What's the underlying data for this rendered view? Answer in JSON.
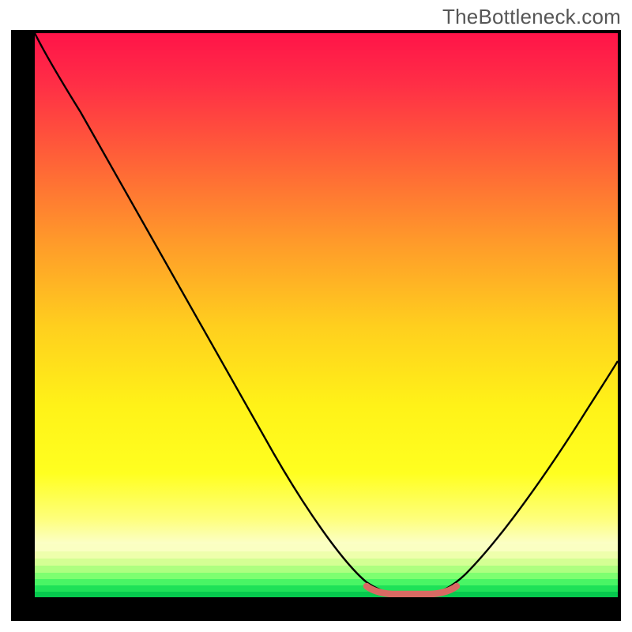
{
  "watermark": "TheBottleneck.com",
  "chart_data": {
    "type": "line",
    "title": "",
    "xlabel": "",
    "ylabel": "",
    "xlim": [
      0,
      100
    ],
    "ylim": [
      0,
      100
    ],
    "series": [
      {
        "name": "bottleneck-curve",
        "x": [
          0,
          5,
          10,
          15,
          20,
          25,
          30,
          35,
          40,
          45,
          50,
          55,
          58,
          60,
          63,
          67,
          70,
          72,
          75,
          80,
          85,
          90,
          95,
          100
        ],
        "values": [
          100,
          92,
          84,
          75,
          67,
          58,
          50,
          42,
          33,
          25,
          16.5,
          8,
          3,
          1,
          0,
          0,
          0.5,
          2,
          5,
          12,
          20,
          29,
          38,
          47
        ]
      }
    ],
    "markers": {
      "name": "optimal-range",
      "x": [
        57,
        59,
        61,
        63,
        65,
        67,
        69,
        71
      ],
      "y": [
        0.9,
        0.5,
        0.3,
        0.3,
        0.3,
        0.3,
        0.5,
        0.9
      ],
      "color": "#d96a63"
    },
    "background": {
      "gradient": [
        "#ff1a4a",
        "#ff6a3c",
        "#ffc228",
        "#ffff1a",
        "#fdffb0"
      ],
      "bottom_bands": [
        "#f7ffa9",
        "#d8ff8e",
        "#9fff7c",
        "#5fff6e",
        "#20e85e",
        "#06c94e"
      ]
    }
  }
}
